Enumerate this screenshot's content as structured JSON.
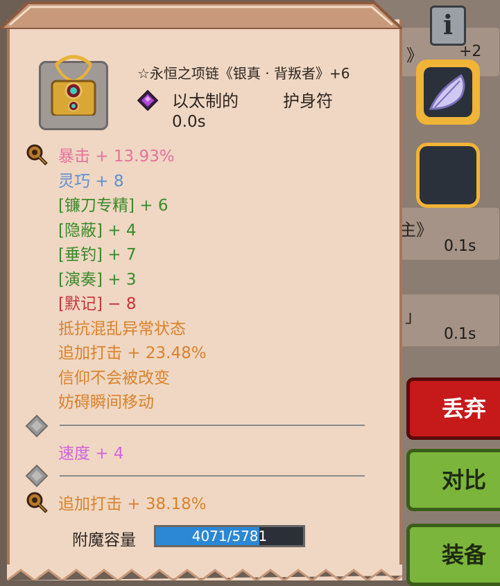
{
  "item": {
    "title": "☆永恒之项链《银真 · 背叛者》+6",
    "quality": "以太制的",
    "category": "护身符",
    "cooldown": "0.0s"
  },
  "stats": [
    {
      "text": "暴击 + 13.93%",
      "color": "#e6729a",
      "marker": "rune-icon"
    },
    {
      "text": "灵巧 + 8",
      "color": "#5d8fcf",
      "marker": null
    },
    {
      "text": "[镰刀专精] + 6",
      "color": "#3a8a2a",
      "marker": null
    },
    {
      "text": "[隐蔽] + 4",
      "color": "#3a8a2a",
      "marker": null
    },
    {
      "text": "[垂钓] + 7",
      "color": "#3a8a2a",
      "marker": null
    },
    {
      "text": "[演奏] + 3",
      "color": "#3a8a2a",
      "marker": null
    },
    {
      "text": "[默记] − 8",
      "color": "#c8343a",
      "marker": null
    },
    {
      "text": "抵抗混乱异常状态",
      "color": "#d9822b",
      "marker": null
    },
    {
      "text": "追加打击 + 23.48%",
      "color": "#d9822b",
      "marker": null
    },
    {
      "text": "信仰不会被改变",
      "color": "#d9822b",
      "marker": null
    },
    {
      "text": "妨碍瞬间移动",
      "color": "#d9822b",
      "marker": null
    }
  ],
  "socket_stats": [
    {
      "text": "速度 + 4",
      "color": "#d166d9"
    },
    {
      "text": "追加打击 + 38.18%",
      "color": "#d9822b"
    }
  ],
  "enchant": {
    "label": "附魔容量",
    "current": 4071,
    "max": 5781,
    "display": "4071/5781"
  },
  "background": {
    "card1": "》",
    "card1_suffix": "+2",
    "card2": "主》",
    "time1": "0.1s",
    "card3": "」",
    "time2": "0.1s"
  },
  "buttons": {
    "info": "i",
    "discard": "丢弃",
    "compare": "对比",
    "equip": "装备"
  },
  "colors": {
    "panel": "#efd7c3",
    "border": "#a8765a",
    "slot_border": "#f0b436",
    "discard": "#c61a1a",
    "confirm": "#7bb53b"
  }
}
